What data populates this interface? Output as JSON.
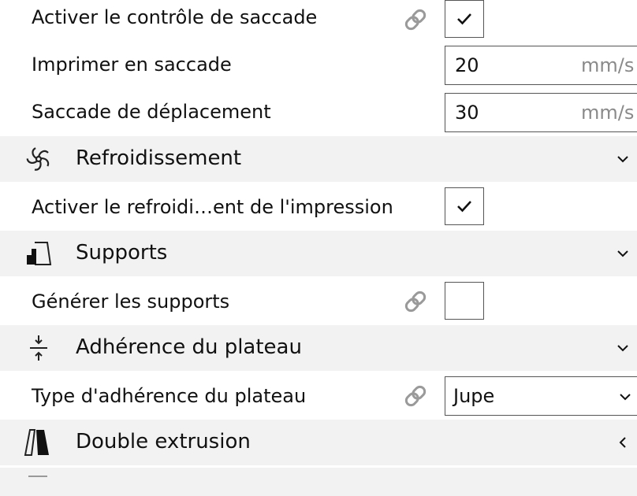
{
  "settings": {
    "jerk_enable": {
      "label": "Activer le contrôle de saccade",
      "checked": true,
      "linked": true
    },
    "jerk_print": {
      "label": "Imprimer en saccade",
      "value": "20",
      "unit": "mm/s"
    },
    "jerk_travel": {
      "label": "Saccade de déplacement",
      "value": "30",
      "unit": "mm/s"
    },
    "cooling_enable": {
      "label": "Activer le refroidi…ent de l'impression",
      "checked": true
    },
    "support_enable": {
      "label": "Générer les supports",
      "checked": false,
      "linked": true
    },
    "adhesion_type": {
      "label": "Type d'adhérence du plateau",
      "value": "Jupe",
      "linked": true
    }
  },
  "sections": {
    "cooling": {
      "title": "Refroidissement",
      "icon": "fan-icon",
      "state": "expanded"
    },
    "support": {
      "title": "Supports",
      "icon": "support-icon",
      "state": "expanded"
    },
    "adhesion": {
      "title": "Adhérence du plateau",
      "icon": "adhesion-icon",
      "state": "expanded"
    },
    "dual": {
      "title": "Double extrusion",
      "icon": "dual-extrusion-icon",
      "state": "collapsed"
    }
  },
  "colors": {
    "section_bg": "#f2f2f2",
    "text": "#111111",
    "unit": "#8a8a8a",
    "border": "#555555"
  }
}
